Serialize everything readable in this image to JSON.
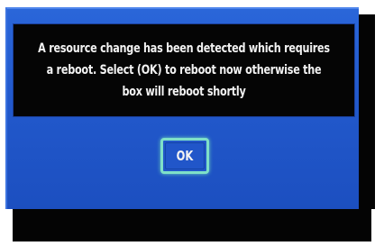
{
  "dialog": {
    "message": "A resource change has been detected which requires a reboot. Select (OK) to reboot now otherwise the box will reboot shortly",
    "ok_label": "OK"
  },
  "colors": {
    "dialog_blue": "#2259cc",
    "message_background": "#050505",
    "message_text": "#f2f2f2",
    "focus_highlight": "#7fe0c8",
    "shadow": "#040404"
  }
}
